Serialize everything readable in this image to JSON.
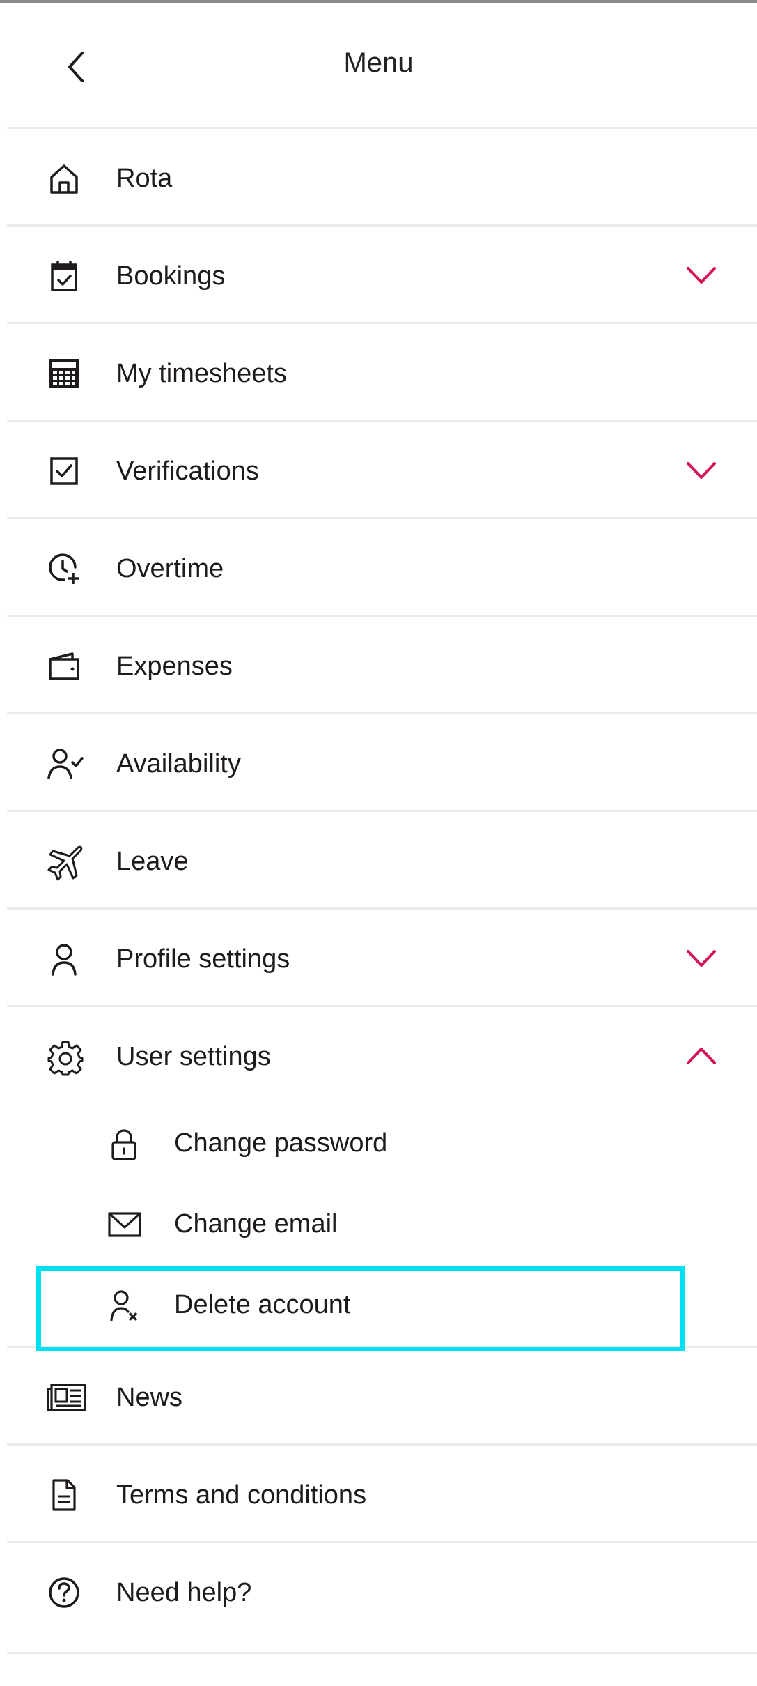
{
  "header": {
    "title": "Menu",
    "back_icon": "chevron-left-icon"
  },
  "colors": {
    "accent": "#d4145a",
    "highlight": "#00e1f5",
    "divider": "#ececec",
    "text": "#1f1a1c"
  },
  "menu": {
    "items": [
      {
        "label": "Rota",
        "icon": "home-icon"
      },
      {
        "label": "Bookings",
        "icon": "calendar-check-icon",
        "expandable": true,
        "expanded": false
      },
      {
        "label": "My timesheets",
        "icon": "calculator-icon"
      },
      {
        "label": "Verifications",
        "icon": "checkbox-icon",
        "expandable": true,
        "expanded": false
      },
      {
        "label": "Overtime",
        "icon": "clock-plus-icon"
      },
      {
        "label": "Expenses",
        "icon": "wallet-icon"
      },
      {
        "label": "Availability",
        "icon": "user-check-icon"
      },
      {
        "label": "Leave",
        "icon": "plane-icon"
      },
      {
        "label": "Profile settings",
        "icon": "user-icon",
        "expandable": true,
        "expanded": false
      },
      {
        "label": "User settings",
        "icon": "gear-icon",
        "expandable": true,
        "expanded": true
      },
      {
        "label": "News",
        "icon": "newspaper-icon"
      },
      {
        "label": "Terms and conditions",
        "icon": "document-icon"
      },
      {
        "label": "Need help?",
        "icon": "help-circle-icon"
      }
    ],
    "user_settings_children": [
      {
        "label": "Change password",
        "icon": "lock-icon"
      },
      {
        "label": "Change email",
        "icon": "mail-icon"
      },
      {
        "label": "Delete account",
        "icon": "user-x-icon",
        "highlighted": true
      }
    ]
  }
}
